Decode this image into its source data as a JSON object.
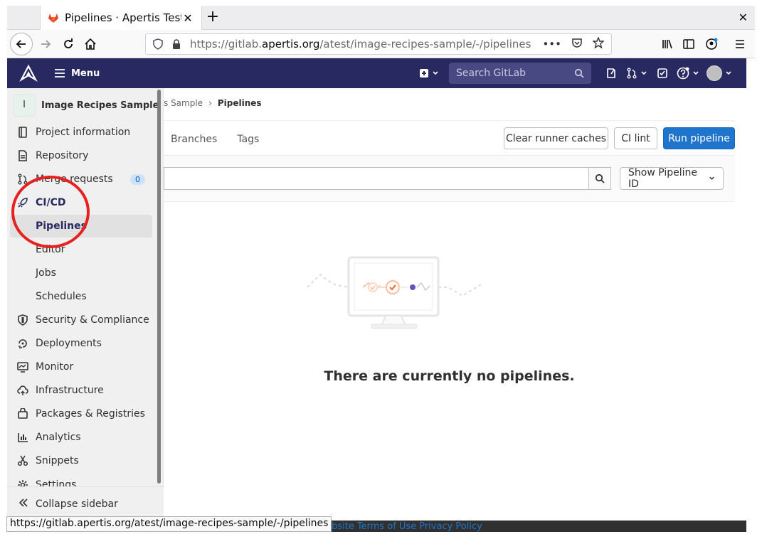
{
  "browser": {
    "tab_title": "Pipelines · Apertis Test / I",
    "tab_close": "✕",
    "new_tab": "+",
    "window_close": "✕",
    "url_prefix": "https://gitlab.",
    "url_domain": "apertis.org",
    "url_path": "/atest/image-recipes-sample/-/pipelines",
    "url_more": "•••",
    "status_url": "https://gitlab.apertis.org/atest/image-recipes-sample/-/pipelines"
  },
  "header": {
    "menu_label": "Menu",
    "search_placeholder": "Search GitLab"
  },
  "sidebar": {
    "project_initial": "I",
    "project_name": "Image Recipes Sample",
    "items": [
      {
        "label": "Project information"
      },
      {
        "label": "Repository"
      },
      {
        "label": "Merge requests",
        "badge": "0"
      },
      {
        "label": "CI/CD"
      },
      {
        "label": "Pipelines"
      },
      {
        "label": "Editor"
      },
      {
        "label": "Jobs"
      },
      {
        "label": "Schedules"
      },
      {
        "label": "Security & Compliance"
      },
      {
        "label": "Deployments"
      },
      {
        "label": "Monitor"
      },
      {
        "label": "Infrastructure"
      },
      {
        "label": "Packages & Registries"
      },
      {
        "label": "Analytics"
      },
      {
        "label": "Snippets"
      },
      {
        "label": "Settings"
      }
    ],
    "collapse_label": "Collapse sidebar"
  },
  "main": {
    "breadcrumb_prev": "s Sample",
    "breadcrumb_sep": "›",
    "breadcrumb_current": "Pipelines",
    "tabs": [
      "Branches",
      "Tags"
    ],
    "buttons": {
      "clear_cache": "Clear runner caches",
      "ci_lint": "CI lint",
      "run_pipeline": "Run pipeline"
    },
    "filter_select": "Show Pipeline ID",
    "empty_message": "There are currently no pipelines."
  },
  "footer": {
    "links": [
      "Website",
      "Terms of Use",
      "Privacy Policy"
    ]
  },
  "colors": {
    "header_bg": "#292961",
    "primary": "#1f75cb",
    "annotation": "#e8201e"
  }
}
